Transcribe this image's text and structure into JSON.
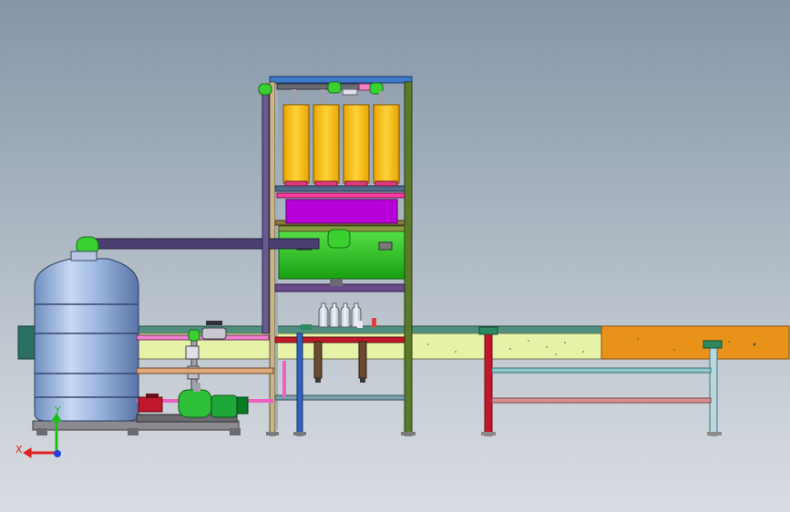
{
  "view": {
    "title": "",
    "colors": {
      "background_top": "#8596a8",
      "background_bottom": "#d8dde2",
      "frame_top": "#3d78c9",
      "frame_post": "#c8b58a",
      "tank_shell": "#8fb0dc",
      "conveyor_main": "#e6f2a8",
      "conveyor_end": "#e8921a",
      "conveyor_side": "#2b6e62",
      "fill_tanks": "#ffc21a",
      "magenta_box": "#b800d8",
      "green_box": "#24c81a",
      "pipe_purple": "#4a3f70",
      "pump_motor": "#1fa83a",
      "valve_red": "#c0182a"
    }
  },
  "axis_triad": {
    "x_label": "X",
    "y_label": "Y",
    "x_color": "#e02020",
    "y_color": "#18c018",
    "z_color": "#2040e0"
  },
  "components": {
    "fill_tank_count": 4,
    "bottle_count": 4
  }
}
